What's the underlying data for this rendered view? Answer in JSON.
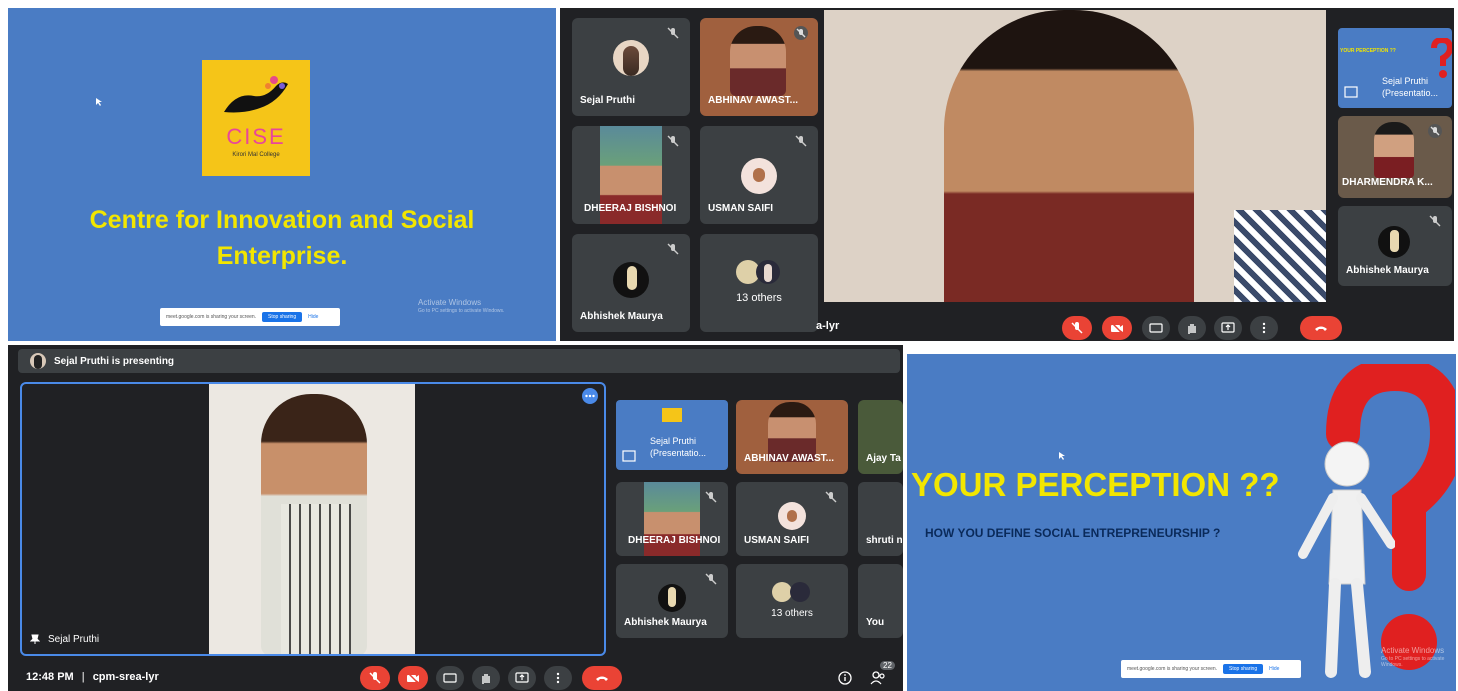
{
  "panel_tl": {
    "logo_title": "CISE",
    "logo_subtitle": "Kirori Mal College",
    "heading_line1": "Centre for Innovation and Social",
    "heading_line2": "Enterprise.",
    "share_text": "meet.google.com is sharing your screen.",
    "stop_sharing": "Stop sharing",
    "hide": "Hide",
    "activate_title": "Activate Windows",
    "activate_sub": "Go to PC settings to activate Windows."
  },
  "panel_tr": {
    "tiles": [
      {
        "name": "Sejal Pruthi"
      },
      {
        "name": "ABHINAV AWAST..."
      },
      {
        "name": "DHEERAJ BISHNOI"
      },
      {
        "name": "USMAN SAIFI"
      },
      {
        "name": "Abhishek Maurya"
      },
      {
        "name": "13 others"
      }
    ],
    "meeting_code_partial": "a-lyr",
    "side_tiles": [
      {
        "title": "YOUR PERCEPTION ??",
        "name": "Sejal Pruthi",
        "sub": "(Presentatio..."
      },
      {
        "name": "DHARMENDRA K..."
      },
      {
        "name": "Abhishek Maurya"
      }
    ]
  },
  "panel_bl": {
    "presenting_text": "Sejal Pruthi is presenting",
    "main_name": "Sejal Pruthi",
    "time": "12:48 PM",
    "separator": "|",
    "meeting_code": "cpm-srea-lyr",
    "participant_count": "22",
    "tiles": [
      {
        "name": "Sejal Pruthi",
        "sub": "(Presentatio..."
      },
      {
        "name": "ABHINAV AWAST..."
      },
      {
        "name": "Ajay Ta"
      },
      {
        "name": "DHEERAJ BISHNOI"
      },
      {
        "name": "USMAN SAIFI"
      },
      {
        "name": "shruti n"
      },
      {
        "name": "Abhishek Maurya"
      },
      {
        "name": "13 others"
      },
      {
        "name": "You"
      }
    ]
  },
  "panel_br": {
    "heading": "YOUR PERCEPTION ??",
    "subheading": "HOW YOU DEFINE SOCIAL ENTREPRENEURSHIP ?",
    "share_text": "meet.google.com is sharing your screen.",
    "stop_sharing": "Stop sharing",
    "hide": "Hide",
    "activate_title": "Activate Windows",
    "activate_sub": "Go to PC settings to activate Windows."
  },
  "colors": {
    "slide_blue": "#4a7cc4",
    "heading_yellow": "#f2e600",
    "meet_dark": "#202124",
    "tile_grey": "#3c4043",
    "end_red": "#ea4335",
    "accent_blue": "#1a73e8",
    "logo_yellow": "#f5c518"
  }
}
